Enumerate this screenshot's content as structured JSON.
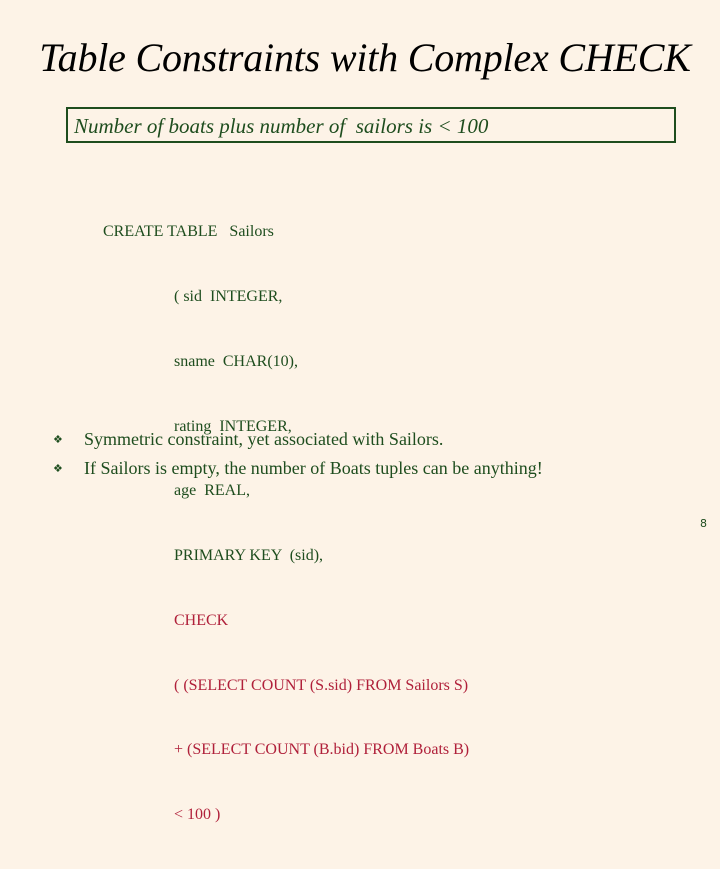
{
  "slide": {
    "title": "Table Constraints with Complex CHECK",
    "callout": "Number of boats plus number of  sailors is < 100",
    "code": {
      "header": "CREATE TABLE   Sailors",
      "lines": [
        {
          "text": "( sid  INTEGER,",
          "color": "green"
        },
        {
          "text": "sname  CHAR(10),",
          "color": "green"
        },
        {
          "text": "rating  INTEGER,",
          "color": "green"
        },
        {
          "text": "age  REAL,",
          "color": "green"
        },
        {
          "text": "PRIMARY KEY  (sid),",
          "color": "green"
        },
        {
          "text": "CHECK",
          "color": "red"
        },
        {
          "text": "( (SELECT COUNT (S.sid) FROM Sailors S)",
          "color": "red"
        },
        {
          "text": "+ (SELECT COUNT (B.bid) FROM Boats B)",
          "color": "red"
        },
        {
          "text": "< 100 )",
          "color": "red"
        }
      ]
    },
    "bullets": [
      {
        "icon": "diamond-star-bullet-icon",
        "glyph": "❖",
        "text": "Symmetric constraint, yet associated with Sailors."
      },
      {
        "icon": "diamond-star-bullet-icon",
        "glyph": "❖",
        "text": "If Sailors is empty, the number of Boats tuples can be anything!"
      }
    ],
    "page_number": "8"
  },
  "colors": {
    "background": "#fdf3e7",
    "green": "#1e4d1e",
    "red": "#b0203a",
    "title": "#000000"
  }
}
